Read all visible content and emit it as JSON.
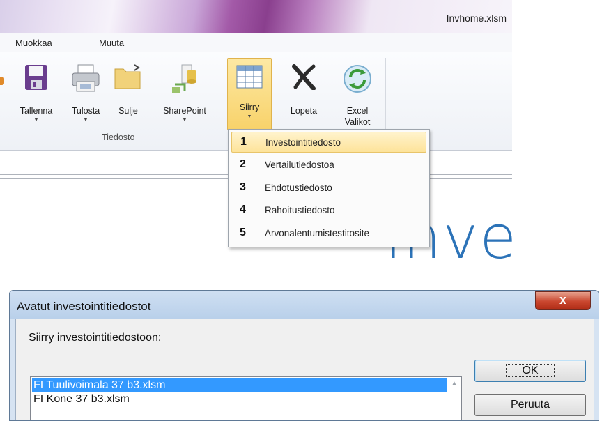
{
  "window": {
    "file_title": "Invhome.xlsm"
  },
  "menubar": {
    "items": [
      "Muokkaa",
      "Muuta"
    ]
  },
  "ribbon": {
    "buttons": [
      {
        "label": "Tallenna",
        "icon": "save-icon"
      },
      {
        "label": "Tulosta",
        "icon": "printer-icon"
      },
      {
        "label": "Sulje",
        "icon": "folder-close-icon"
      },
      {
        "label": "SharePoint",
        "icon": "sharepoint-icon"
      },
      {
        "label": "Siirry",
        "icon": "grid-icon"
      },
      {
        "label": "Lopeta",
        "icon": "x-icon"
      },
      {
        "label": "Excel",
        "label2": "Valikot",
        "icon": "excel-refresh-icon"
      }
    ],
    "group_label": "Tiedosto"
  },
  "dropdown": {
    "items": [
      {
        "num": "1",
        "label": "Investointitiedosto"
      },
      {
        "num": "2",
        "label": "Vertailutiedostoa"
      },
      {
        "num": "3",
        "label": "Ehdotustiedosto"
      },
      {
        "num": "4",
        "label": "Rahoitustiedosto"
      },
      {
        "num": "5",
        "label": "Arvonalentumistestitosite"
      }
    ]
  },
  "background_text": "inve",
  "dialog": {
    "title": "Avatut investointitiedostot",
    "close_label": "x",
    "prompt": "Siirry investointitiedostoon:",
    "files": [
      "FI Tuulivoimala 37 b3.xlsm",
      "FI Kone 37 b3.xlsm"
    ],
    "ok_label": "OK",
    "cancel_label": "Peruuta"
  },
  "colors": {
    "accent": "#3399ff",
    "highlight": "#fde39a",
    "brand_blue": "#2c73b8",
    "close_red": "#c9462e"
  }
}
